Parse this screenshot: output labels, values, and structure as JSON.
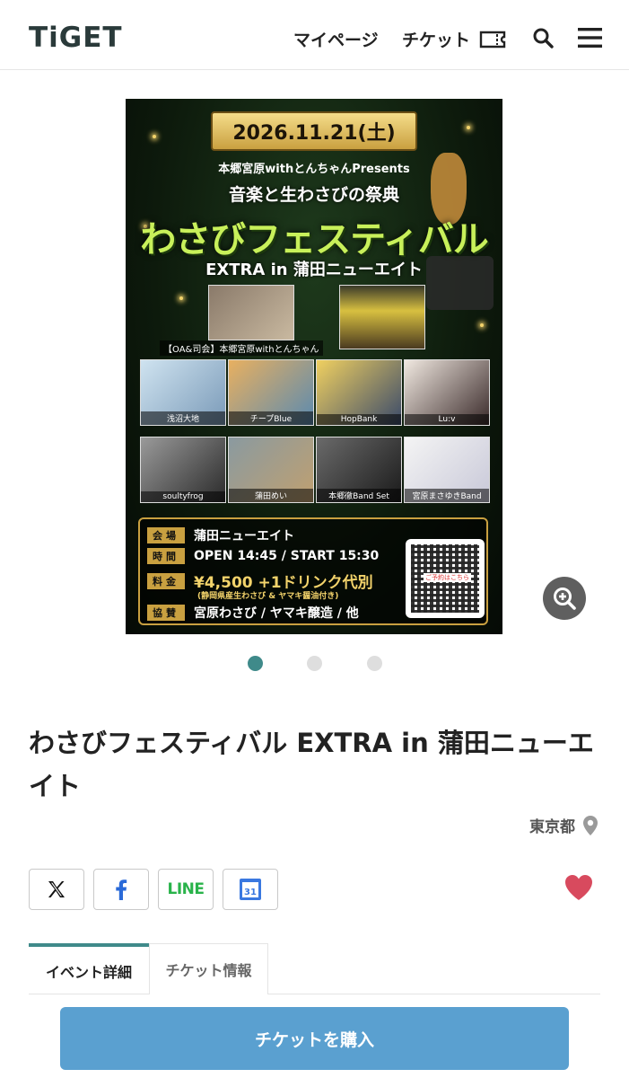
{
  "header": {
    "logo_text": "TiGET",
    "mypage_label": "マイページ",
    "ticket_label": "チケット"
  },
  "poster": {
    "date": "2026.11.21(土)",
    "presents": "本郷宮原withとんちゃんPresents",
    "subtitle": "音楽と生わさびの祭典",
    "title": "わさびフェスティバル",
    "extra": "EXTRA in 蒲田ニューエイト",
    "host_caption": "【OA&司会】本郷宮原withとんちゃん",
    "performers": [
      "浅沼大地",
      "チープBlue",
      "HopBank",
      "Lu:v",
      "soultyfrog",
      "蒲田めい",
      "本郷徹Band Set",
      "宮原まさゆきBand"
    ],
    "info": {
      "venue_key": "会場",
      "venue": "蒲田ニューエイト",
      "time_key": "時間",
      "time": "OPEN 14:45 / START 15:30",
      "price_key": "料金",
      "price": "¥4,500 +1ドリンク代別",
      "price_note": "(静岡県産生わさび & ヤマキ醤油付き)",
      "sponsor_key": "協賛",
      "sponsor": "宮原わさび / ヤマキ醸造 / 他"
    },
    "qr_label": "ご予約はこちら"
  },
  "carousel": {
    "count": 3,
    "active": 0
  },
  "event": {
    "title": "わさびフェスティバル EXTRA in 蒲田ニューエイト",
    "location": "東京都"
  },
  "share": {
    "line_label": "LINE",
    "calendar_day": "31"
  },
  "tabs": [
    {
      "label": "イベント詳細",
      "active": true
    },
    {
      "label": "チケット情報",
      "active": false
    }
  ],
  "buy_button_label": "チケットを購入",
  "colors": {
    "accent": "#3f8a8a",
    "buy_button": "#5aa0d0",
    "heart": "#d84a5e",
    "line_green": "#29b34a"
  }
}
